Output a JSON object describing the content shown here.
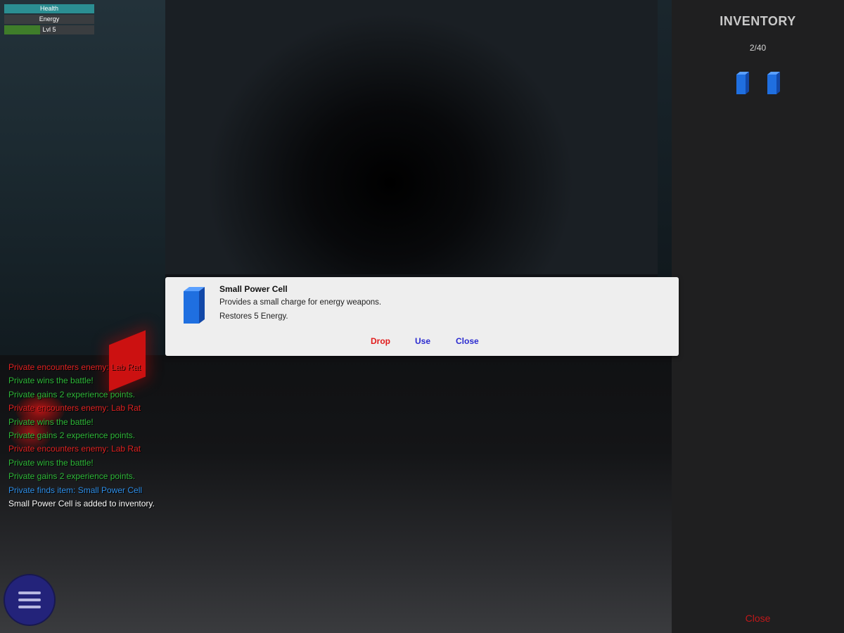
{
  "stats": [
    {
      "label": "Health",
      "level": 1.0,
      "color": "#2b8e92"
    },
    {
      "label": "Energy",
      "level": 0.0,
      "color": "#2b8e92"
    },
    {
      "label": "Lvl 5",
      "level": 0.4,
      "color": "#3f7d2a"
    }
  ],
  "log": [
    {
      "text": "Private encounters enemy: Lab Rat",
      "color": "#e02222"
    },
    {
      "text": "Private wins the battle!",
      "color": "#2fb83a"
    },
    {
      "text": "Private gains 2 experience points.",
      "color": "#2fb83a"
    },
    {
      "text": "Private encounters enemy: Lab Rat",
      "color": "#e02222"
    },
    {
      "text": "Private wins the battle!",
      "color": "#2fb83a"
    },
    {
      "text": "Private gains 2 experience points.",
      "color": "#2fb83a"
    },
    {
      "text": "Private encounters enemy: Lab Rat",
      "color": "#e02222"
    },
    {
      "text": "Private wins the battle!",
      "color": "#2fb83a"
    },
    {
      "text": "Private gains 2 experience points.",
      "color": "#2fb83a"
    },
    {
      "text": "Private finds item: Small Power Cell",
      "color": "#2f8fe8"
    },
    {
      "text": "Small Power Cell is added to inventory.",
      "color": "#ffffff"
    }
  ],
  "menu": {
    "icon": "hamburger-menu-icon",
    "color": "#23237a"
  },
  "inventory": {
    "title": "INVENTORY",
    "count": "2/40",
    "items": [
      {
        "icon": "power-cell-icon",
        "color": "#1f6fe0"
      },
      {
        "icon": "power-cell-icon",
        "color": "#1f6fe0"
      }
    ],
    "close_label": "Close"
  },
  "dialog": {
    "icon": "power-cell-icon",
    "title": "Small Power Cell",
    "description": "Provides a small charge for energy weapons.",
    "effect": "Restores 5 Energy.",
    "drop_label": "Drop",
    "use_label": "Use",
    "close_label": "Close",
    "drop_color": "#e11b1b",
    "action_color": "#2a2ad0"
  }
}
